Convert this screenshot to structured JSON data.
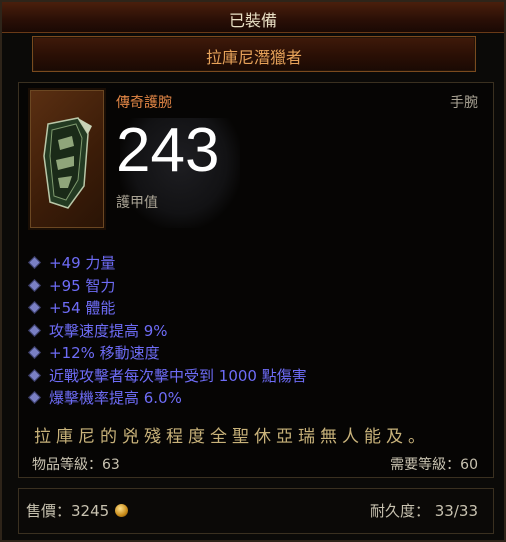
{
  "header": {
    "equipped_label": "已裝備"
  },
  "item": {
    "name": "拉庫尼潛獵者",
    "type": "傳奇護腕",
    "slot": "手腕",
    "armor_value": "243",
    "armor_label": "護甲值",
    "icon": "bracer-icon",
    "properties": [
      "+49 力量",
      "+95 智力",
      "+54 體能",
      "攻擊速度提高 9%",
      "+12% 移動速度",
      "近戰攻擊者每次擊中受到 1000 點傷害",
      "爆擊機率提高 6.0%"
    ],
    "flavor_text": "拉庫尼的兇殘程度全聖休亞瑞無人能及。",
    "item_level": "物品等級：63",
    "required_level": "需要等級：60"
  },
  "footer": {
    "sell_value": "售價：3245",
    "gold_icon": "gold-coin-icon",
    "durability": "耐久度： 33/33"
  },
  "colors": {
    "legendary_orange": "#e6a25a",
    "magic_blue": "#6e6cf6",
    "flavor_gold": "#c8b27a"
  }
}
